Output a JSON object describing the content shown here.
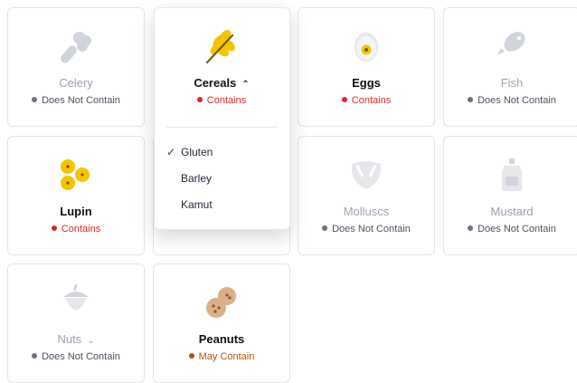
{
  "allergens": [
    {
      "id": "celery",
      "name": "Celery",
      "status": "Does Not Contain",
      "state": "none",
      "icon": "celery-icon"
    },
    {
      "id": "cereals",
      "name": "Cereals",
      "status": "Contains",
      "state": "contains",
      "icon": "wheat-icon",
      "expanded": true
    },
    {
      "id": "eggs",
      "name": "Eggs",
      "status": "Contains",
      "state": "contains",
      "icon": "egg-icon"
    },
    {
      "id": "fish",
      "name": "Fish",
      "status": "Does Not Contain",
      "state": "none",
      "icon": "fish-icon"
    },
    {
      "id": "lupin",
      "name": "Lupin",
      "status": "Contains",
      "state": "contains",
      "icon": "lupin-icon"
    },
    {
      "id": "molluscs",
      "name": "Molluscs",
      "status": "Does Not Contain",
      "state": "none",
      "icon": "mollusc-icon"
    },
    {
      "id": "mustard",
      "name": "Mustard",
      "status": "Does Not Contain",
      "state": "none",
      "icon": "mustard-icon"
    },
    {
      "id": "nuts",
      "name": "Nuts",
      "status": "Does Not Contain",
      "state": "none",
      "icon": "nut-icon"
    },
    {
      "id": "peanuts",
      "name": "Peanuts",
      "status": "May Contain",
      "state": "may",
      "icon": "peanut-icon"
    }
  ],
  "cereals_menu": {
    "options": [
      {
        "label": "Gluten",
        "checked": true
      },
      {
        "label": "Barley",
        "checked": false
      },
      {
        "label": "Kamut",
        "checked": false
      }
    ]
  },
  "colors": {
    "contains": "#dc2626",
    "may_contain": "#b45309",
    "does_not_contain": "#6b7280",
    "accent_yellow": "#f5c400"
  }
}
